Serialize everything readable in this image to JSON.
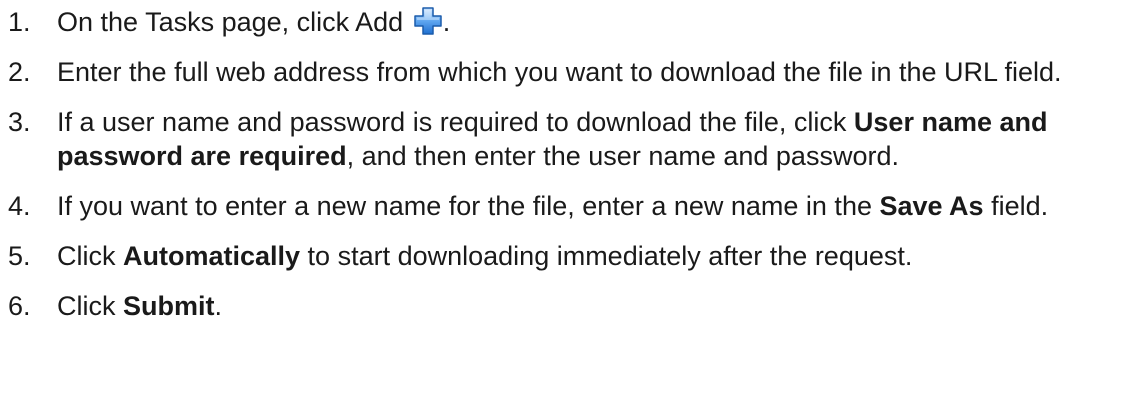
{
  "steps": [
    {
      "number": "1.",
      "parts": [
        {
          "text": "On the Tasks page, click Add ",
          "bold": false
        },
        {
          "icon": "add-plus-icon"
        },
        {
          "text": ".",
          "bold": false
        }
      ]
    },
    {
      "number": "2.",
      "parts": [
        {
          "text": "Enter the full web address from which you want to download the file in the URL field.",
          "bold": false
        }
      ]
    },
    {
      "number": "3.",
      "parts": [
        {
          "text": "If a user name and password is required to download the file, click ",
          "bold": false
        },
        {
          "text": "User name and password are required",
          "bold": true
        },
        {
          "text": ", and then enter the user name and password.",
          "bold": false
        }
      ]
    },
    {
      "number": "4.",
      "parts": [
        {
          "text": "If you want to enter a new name for the file, enter a new name in the ",
          "bold": false
        },
        {
          "text": "Save As",
          "bold": true
        },
        {
          "text": " field.",
          "bold": false
        }
      ]
    },
    {
      "number": "5.",
      "parts": [
        {
          "text": "Click ",
          "bold": false
        },
        {
          "text": "Automatically",
          "bold": true
        },
        {
          "text": " to start downloading immediately after the request.",
          "bold": false
        }
      ]
    },
    {
      "number": "6.",
      "parts": [
        {
          "text": "Click ",
          "bold": false
        },
        {
          "text": "Submit",
          "bold": true
        },
        {
          "text": ".",
          "bold": false
        }
      ]
    }
  ],
  "colors": {
    "text": "#1a1a1a",
    "icon_blue": "#2f7fd9",
    "icon_light": "#a9d2ff",
    "icon_dark": "#1b5cab"
  }
}
